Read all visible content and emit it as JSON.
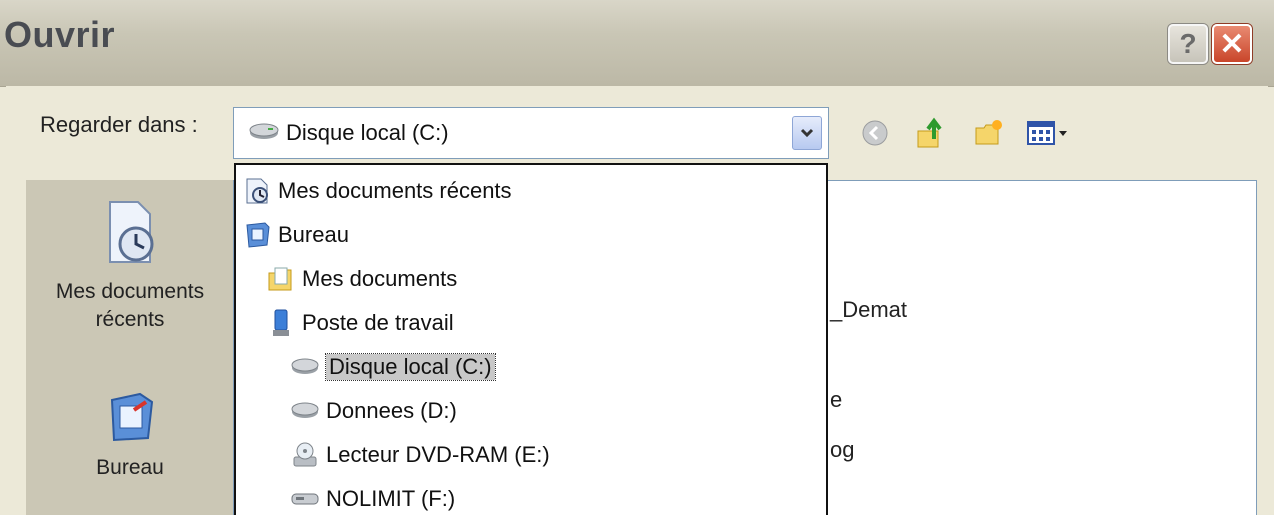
{
  "window": {
    "title": "Ouvrir",
    "help_label": "?",
    "close_label": "✕"
  },
  "look_in": {
    "label": "Regarder dans :",
    "value": "Disque local (C:)"
  },
  "toolbar": [
    "back-icon",
    "up-folder-icon",
    "new-folder-icon",
    "view-menu-icon"
  ],
  "places": [
    {
      "label": "Mes documents\nrécents",
      "icon": "recent-documents-icon"
    },
    {
      "label": "Bureau",
      "icon": "desktop-icon"
    }
  ],
  "dropdown": {
    "items": [
      {
        "label": "Mes documents récents",
        "icon": "recent-documents-icon",
        "indent": 0
      },
      {
        "label": "Bureau",
        "icon": "desktop-icon",
        "indent": 0
      },
      {
        "label": "Mes documents",
        "icon": "my-documents-icon",
        "indent": 1
      },
      {
        "label": "Poste de travail",
        "icon": "my-computer-icon",
        "indent": 1
      },
      {
        "label": "Disque local (C:)",
        "icon": "hard-drive-icon",
        "indent": 2,
        "selected": true
      },
      {
        "label": "Donnees (D:)",
        "icon": "hard-drive-icon",
        "indent": 2
      },
      {
        "label": "Lecteur DVD-RAM (E:)",
        "icon": "dvd-drive-icon",
        "indent": 2
      },
      {
        "label": "NOLIMIT (F:)",
        "icon": "removable-drive-icon",
        "indent": 2
      }
    ]
  },
  "file_list": {
    "visible_fragments": [
      "_Demat",
      "e",
      "og"
    ]
  },
  "colors": {
    "window_bg": "#ECE9D8",
    "close_red": "#c9452a",
    "border_blue": "#7f9db9"
  }
}
